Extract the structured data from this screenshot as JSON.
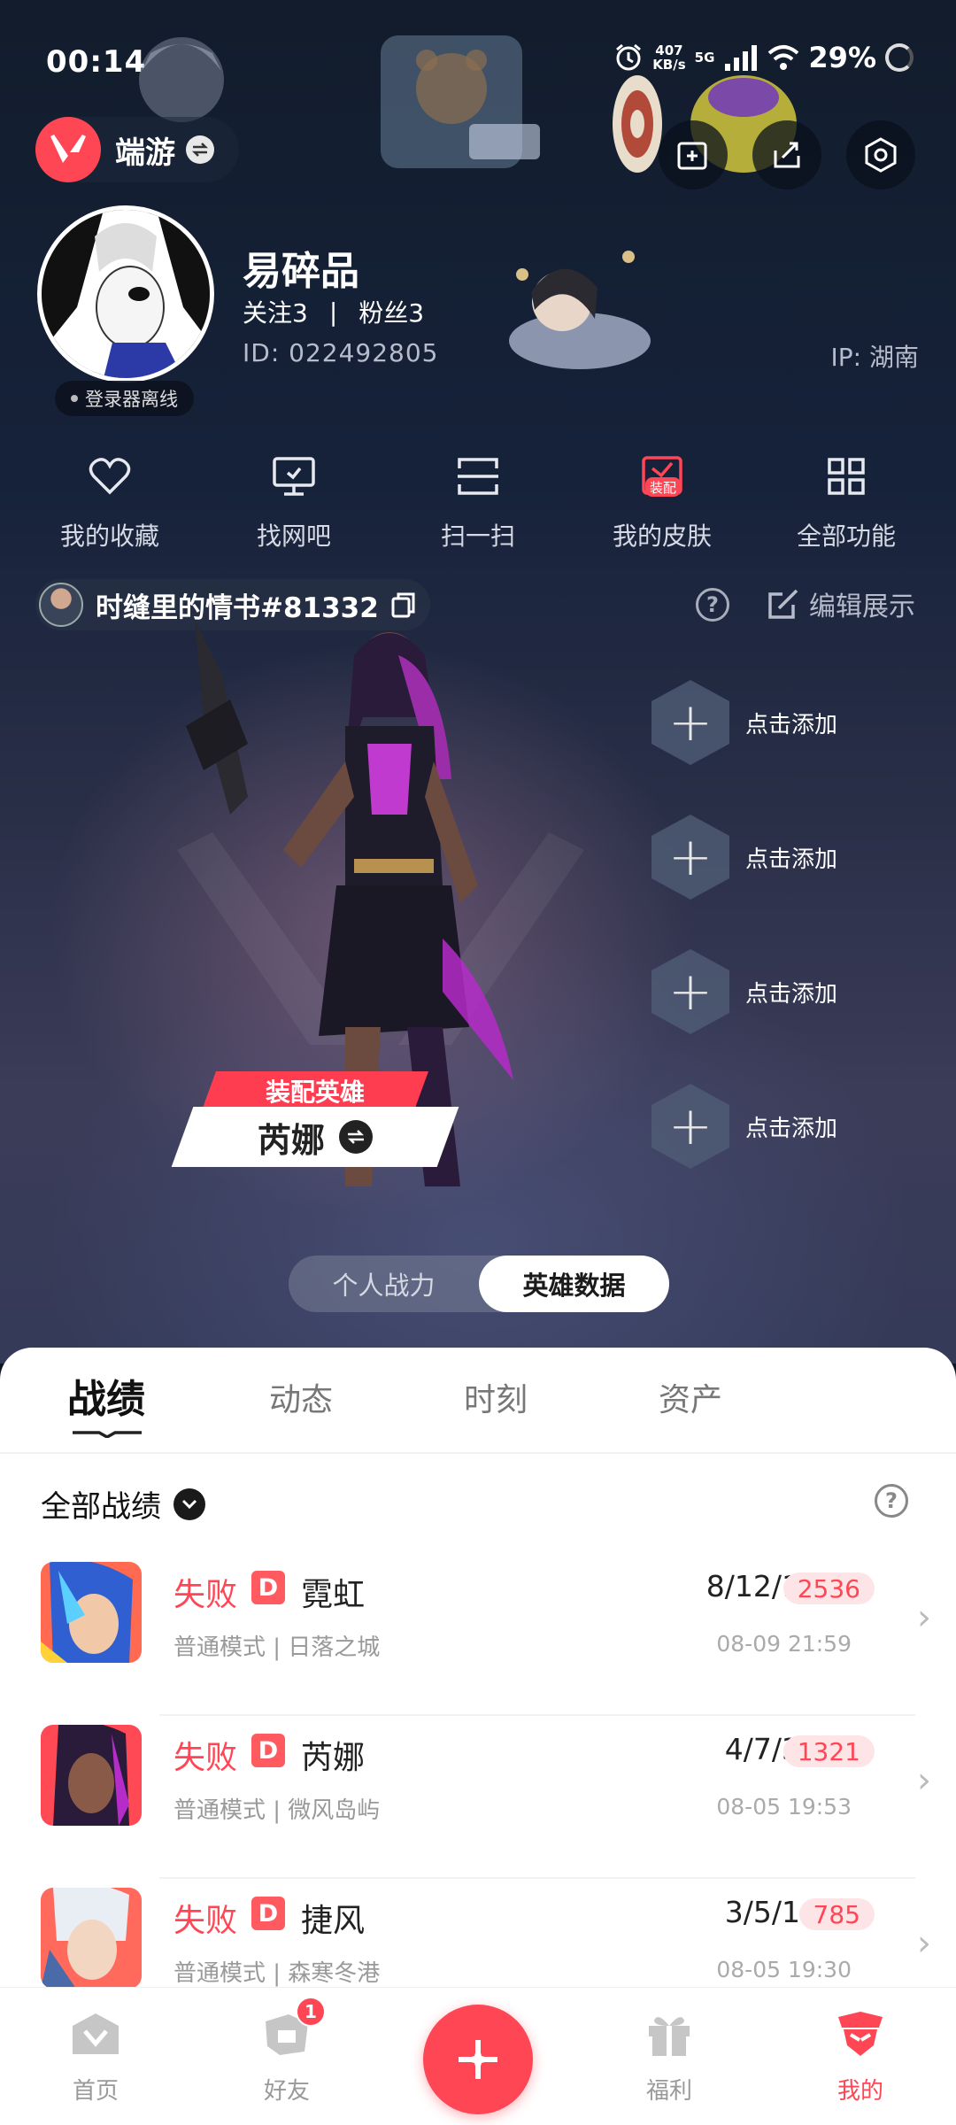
{
  "status_bar": {
    "time": "00:14",
    "net_speed": "407\nKB/s",
    "net_type": "5G",
    "battery": "29%"
  },
  "brand": {
    "name": "端游"
  },
  "profile": {
    "name": "易碎品",
    "follow": "关注3",
    "separator": "|",
    "fans": "粉丝3",
    "id": "ID: 022492805",
    "ip": "IP: 湖南",
    "login_status": "登录器离线"
  },
  "functions": [
    {
      "label": "我的收藏",
      "icon": "heart-icon"
    },
    {
      "label": "找网吧",
      "icon": "monitor-icon"
    },
    {
      "label": "扫一扫",
      "icon": "scan-icon"
    },
    {
      "label": "我的皮肤",
      "icon": "skin-icon",
      "badge": "装配"
    },
    {
      "label": "全部功能",
      "icon": "grid-icon"
    }
  ],
  "player_card": {
    "title": "时缝里的情书#81332",
    "edit_label": "编辑展示",
    "help": "?"
  },
  "hero": {
    "equip_label": "装配英雄",
    "name": "芮娜"
  },
  "slots": [
    "点击添加",
    "点击添加",
    "点击添加",
    "点击添加"
  ],
  "toggle": {
    "left": "个人战力",
    "right": "英雄数据"
  },
  "tabs": [
    "战绩",
    "动态",
    "时刻",
    "资产"
  ],
  "filter": {
    "label": "全部战绩",
    "help": "?"
  },
  "matches": [
    {
      "result": "失败",
      "rank": "D",
      "agent": "霓虹",
      "mode": "普通模式 | 日落之城",
      "kda": "8/12/1",
      "score": "2536",
      "date": "08-09 21:59",
      "avatar_color": "#3a6fd8"
    },
    {
      "result": "失败",
      "rank": "D",
      "agent": "芮娜",
      "mode": "普通模式 | 微风岛屿",
      "kda": "4/7/3",
      "score": "1321",
      "date": "08-05 19:53",
      "avatar_color": "#ff4655"
    },
    {
      "result": "失败",
      "rank": "D",
      "agent": "捷风",
      "mode": "普通模式 | 森寒冬港",
      "kda": "3/5/1",
      "score": "785",
      "date": "08-05 19:30",
      "avatar_color": "#ff6a5c"
    }
  ],
  "nav": [
    {
      "label": "首页",
      "icon": "home-icon"
    },
    {
      "label": "好友",
      "icon": "friends-icon",
      "badge": "1"
    },
    {
      "label": "福利",
      "icon": "gift-icon"
    },
    {
      "label": "我的",
      "icon": "profile-icon"
    }
  ],
  "colors": {
    "accent": "#ff4655",
    "panel": "#ffffff",
    "bg": "#16223a"
  }
}
